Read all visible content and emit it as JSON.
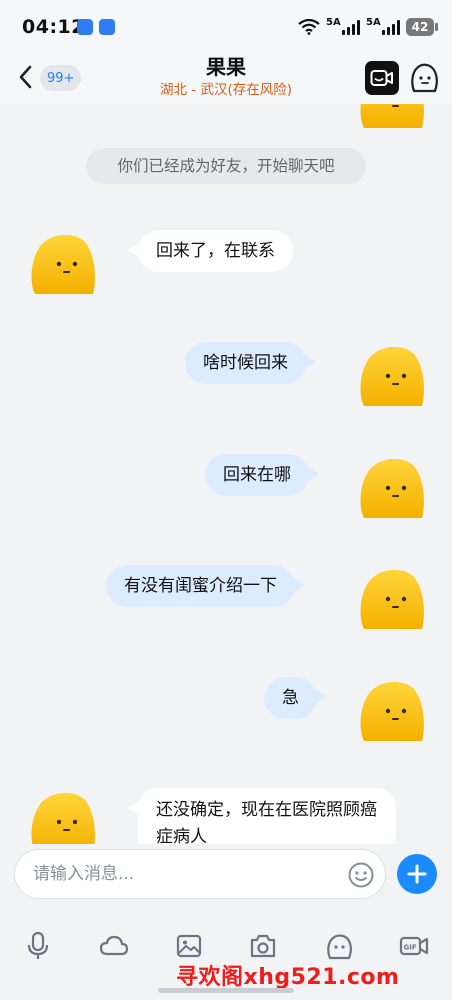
{
  "status_bar": {
    "time": "04:12",
    "network_1": "5A",
    "network_2": "5A",
    "battery": "42",
    "icons": [
      "messages-app-icon",
      "security-app-icon",
      "wifi-icon",
      "signal-icon",
      "signal-icon",
      "battery-icon"
    ]
  },
  "header": {
    "unread_count": "99+",
    "contact_name": "果果",
    "location": "湖北 - 武汉(存在风险)",
    "icons": [
      "back-icon",
      "video-call-icon",
      "profile-icon"
    ]
  },
  "chat": {
    "system_message": "你们已经成为好友，开始聊天吧",
    "messages": [
      {
        "direction": "incoming",
        "text": "回来了，在联系"
      },
      {
        "direction": "outgoing",
        "text": "啥时候回来"
      },
      {
        "direction": "outgoing",
        "text": "回来在哪"
      },
      {
        "direction": "outgoing",
        "text": "有没有闺蜜介绍一下"
      },
      {
        "direction": "outgoing",
        "text": "急"
      },
      {
        "direction": "incoming",
        "text": "还没确定，现在在医院照顾癌症病人"
      }
    ]
  },
  "composer": {
    "placeholder": "请输入消息...",
    "value": "",
    "icons": [
      "emoji-icon",
      "add-icon"
    ]
  },
  "toolbar": {
    "icons": [
      "microphone-icon",
      "cloud-icon",
      "image-icon",
      "camera-icon",
      "emoticon-icon",
      "gif-icon"
    ]
  },
  "watermark": "寻欢阁xhg521.com",
  "colors": {
    "accent": "#1b8cff",
    "outgoing_bubble": "#dcecfe",
    "incoming_bubble": "#ffffff",
    "location_warning": "#e05a14",
    "watermark": "#f01d1d",
    "avatar_yellow": "#f9c112"
  }
}
